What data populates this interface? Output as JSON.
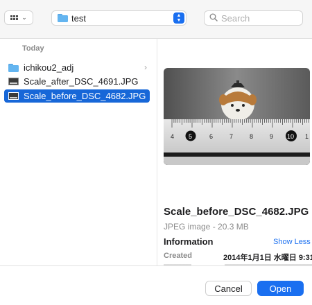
{
  "toolbar": {
    "view_icon": "grid-icon",
    "path_folder": "test",
    "search_placeholder": "Search"
  },
  "sidebar": {
    "section": "Today",
    "items": [
      {
        "label": "ichikou2_adj",
        "icon": "folder-icon",
        "has_children": true
      },
      {
        "label": "Scale_after_DSC_4691.JPG",
        "icon": "image-file-icon"
      },
      {
        "label": "Scale_before_DSC_4682.JPG",
        "icon": "image-file-icon",
        "selected": true
      }
    ]
  },
  "preview": {
    "ruler_numbers": [
      "4",
      "5",
      "6",
      "7",
      "8",
      "9",
      "10",
      "1"
    ],
    "file_name": "Scale_before_DSC_4682.JPG",
    "file_kind": "JPEG image - 20.3 MB",
    "info_header": "Information",
    "show_less": "Show Less",
    "created_label": "Created",
    "created_value": "2014年1月1日 水曜日 9:31"
  },
  "footer": {
    "cancel_label": "Cancel",
    "open_label": "Open"
  },
  "colors": {
    "accent": "#1a6ff0",
    "selection": "#1767d8"
  }
}
